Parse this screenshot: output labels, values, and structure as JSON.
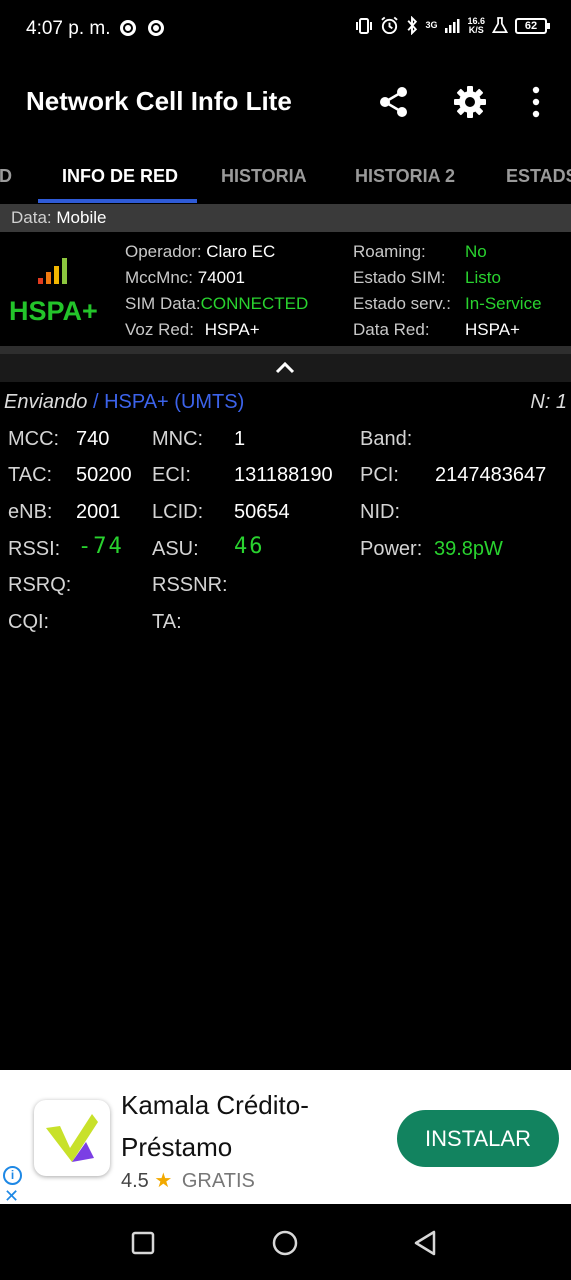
{
  "status_bar": {
    "time": "4:07 p. m.",
    "net_top": "3G",
    "net_speed": "16.6",
    "net_unit": "K/S",
    "battery": "62",
    "icons": [
      "chrome-icon",
      "chrome-icon",
      "vibrate-icon",
      "alarm-icon",
      "bluetooth-icon",
      "signal-icon",
      "flask-icon",
      "battery-icon"
    ]
  },
  "app_bar": {
    "title": "Network Cell Info Lite",
    "icons": [
      "share-icon",
      "settings-icon",
      "more-vert-icon"
    ]
  },
  "tabs": [
    {
      "label": "D"
    },
    {
      "label": "INFO DE RED",
      "active": true
    },
    {
      "label": "HISTORIA"
    },
    {
      "label": "HISTORIA 2"
    },
    {
      "label": "ESTADS"
    }
  ],
  "data_row": {
    "label": "Data:",
    "value": "Mobile"
  },
  "network": {
    "tech": "HSPA+",
    "left": [
      {
        "label": "Operador:",
        "value": "Claro EC"
      },
      {
        "label": "MccMnc:",
        "value": "74001"
      },
      {
        "label": "SIM Data:",
        "value": "CONNECTED"
      },
      {
        "label": "Voz Red:",
        "value": "HSPA+"
      }
    ],
    "right": [
      {
        "label": "Roaming:",
        "value": "No"
      },
      {
        "label": "Estado SIM:",
        "value": "Listo"
      },
      {
        "label": "Estado serv.:",
        "value": "In-Service"
      },
      {
        "label": "Data Red:",
        "value": "HSPA+"
      }
    ]
  },
  "cell": {
    "status": "Enviando",
    "separator": " / ",
    "tech": "HSPA+ (UMTS)",
    "n": "N: 1",
    "mcc_label": "MCC:",
    "mcc": "740",
    "mnc_label": "MNC:",
    "mnc": "1",
    "band_label": "Band:",
    "tac_label": "TAC:",
    "tac": "50200",
    "eci_label": "ECI:",
    "eci": "131188190",
    "pci_label": "PCI:",
    "pci": "2147483647",
    "enb_label": "eNB:",
    "enb": "2001",
    "lcid_label": "LCID:",
    "lcid": "50654",
    "nid_label": "NID:",
    "rssi_label": "RSSI:",
    "rssi": "-74",
    "asu_label": "ASU:",
    "asu": "46",
    "power_label": "Power:",
    "power": "39.8pW",
    "rsrq_label": "RSRQ:",
    "rssnr_label": "RSSNR:",
    "cqi_label": "CQI:",
    "ta_label": "TA:"
  },
  "ad": {
    "title": "Kamala Crédito-Préstamo",
    "rating": "4.5",
    "price": "GRATIS",
    "button": "INSTALAR"
  },
  "colors": {
    "accent": "#2f5bd7",
    "green": "#29d32f",
    "link": "#3c63ea",
    "install_button": "#12835f"
  }
}
